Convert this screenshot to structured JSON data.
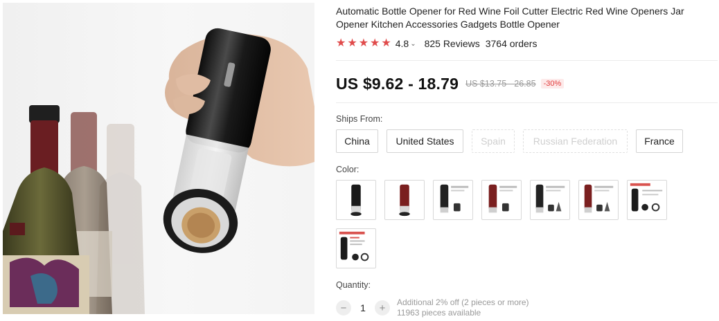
{
  "product": {
    "title": "Automatic Bottle Opener for Red Wine Foil Cutter Electric Red Wine Openers Jar Opener Kitchen Accessories Gadgets Bottle Opener",
    "rating": "4.8",
    "reviews": "825 Reviews",
    "orders": "3764 orders",
    "price": "US $9.62 - 18.79",
    "original_price": "US $13.75 - 26.85",
    "discount": "-30%"
  },
  "ships_from": {
    "label": "Ships From:",
    "options": [
      {
        "label": "China",
        "available": true
      },
      {
        "label": "United States",
        "available": true
      },
      {
        "label": "Spain",
        "available": false
      },
      {
        "label": "Russian Federation",
        "available": false
      },
      {
        "label": "France",
        "available": true
      }
    ]
  },
  "color": {
    "label": "Color:",
    "options_count": 8
  },
  "quantity": {
    "label": "Quantity:",
    "value": "1",
    "minus": "−",
    "plus": "+",
    "discount_note": "Additional 2% off (2 pieces or more)",
    "available": "11963 pieces available"
  },
  "colors": {
    "star": "#e04b4b",
    "discount_text": "#e23b3b",
    "discount_bg": "#fdeaea"
  }
}
